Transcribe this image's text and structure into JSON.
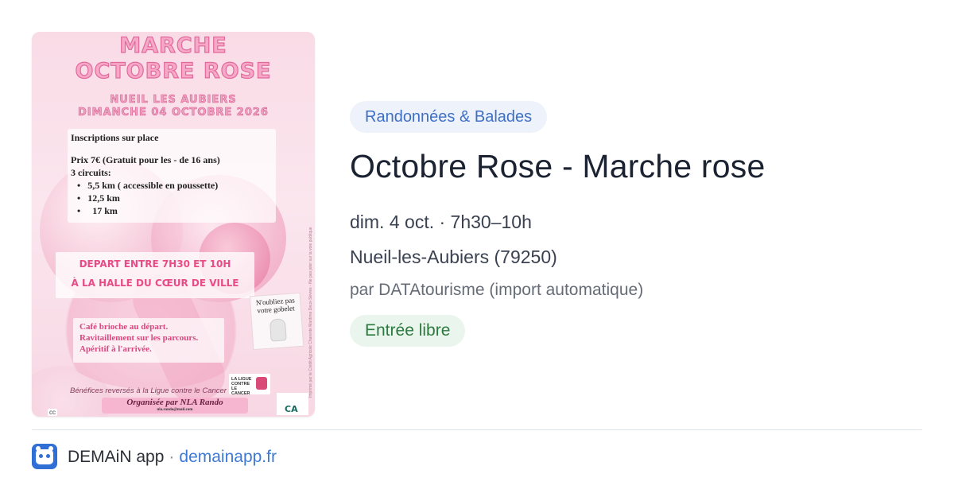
{
  "poster": {
    "title_line1": "MARCHE",
    "title_line2": "OCTOBRE ROSE",
    "location_line": "NUEIL LES AUBIERS",
    "date_line": "DIMANCHE 04 OCTOBRE 2026",
    "inscriptions": "Inscriptions sur place",
    "price_line": "Prix 7€ (Gratuit pour les - de 16 ans)",
    "circuits_label": "3 circuits:",
    "circuits": [
      "5,5 km ( accessible en poussette)",
      "12,5 km",
      "17 km"
    ],
    "depart_line1": "DEPART ENTRE 7H30 ET 10H",
    "depart_line2": "À LA HALLE DU CŒUR DE VILLE",
    "cafe_lines": [
      "Café brioche au départ.",
      "Ravitaillement sur les parcours.",
      "Apéritif à l'arrivée."
    ],
    "gobelet_text": "N'oubliez pas votre gobelet",
    "benefits": "Bénéfices reversés à la Ligue contre le Cancer",
    "ligue_logo_text": "LA LIGUE CONTRE LE CANCER",
    "organizer": "Organisée par NLA Rando",
    "organizer_email": "nla.rando@mail.com",
    "ca_logo_text": "CA",
    "side_text": "Imprimé par le Crédit Agricole Charente Maritime Deux-Sèvres - Ne pas jeter sur la voie publique"
  },
  "event": {
    "category": "Randonnées & Balades",
    "title": "Octobre Rose - Marche rose",
    "datetime": "dim. 4 oct. · 7h30–10h",
    "location": "Nueil-les-Aubiers (79250)",
    "source": "par DATAtourisme (import automatique)",
    "price": "Entrée libre"
  },
  "footer": {
    "app_name": "DEMAiN app",
    "separator": "·",
    "domain": "demainapp.fr",
    "icon": "demain-app-icon"
  },
  "colors": {
    "category_text": "#3f6fc4",
    "category_bg": "#eef3fb",
    "price_text": "#2c7a3f",
    "price_bg": "#eaf6ed",
    "link": "#3f79d6",
    "title": "#1b2232",
    "poster_pink": "#e84b86"
  }
}
